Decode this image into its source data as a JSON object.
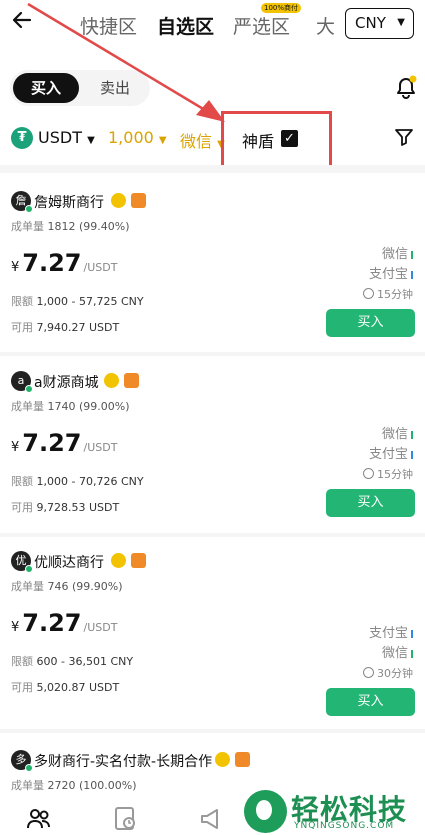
{
  "nav": {
    "back_icon": "back-arrow-icon",
    "tabs": [
      {
        "label": "快捷区",
        "active": false
      },
      {
        "label": "自选区",
        "active": true
      },
      {
        "label": "严选区",
        "active": false,
        "badge": "100%商付"
      },
      {
        "label": "大",
        "active": false
      }
    ],
    "currency": "CNY"
  },
  "trade": {
    "buy_label": "买入",
    "sell_label": "卖出"
  },
  "filters": {
    "coin": "USDT",
    "amount": "1,000",
    "payment": "微信",
    "shield_label": "神盾",
    "shield_checked": true
  },
  "merchants": [
    {
      "avatar": "詹",
      "name": "詹姆斯商行",
      "stats_label": "成单量",
      "stats": "1812 (99.40%)",
      "currency_symbol": "¥",
      "price": "7.27",
      "unit": "/USDT",
      "limit_label": "限额",
      "limit": "1,000 - 57,725 CNY",
      "avail_label": "可用",
      "available": "7,940.27 USDT",
      "payments": [
        "微信",
        "支付宝"
      ],
      "time": "15分钟",
      "buy_label": "买入"
    },
    {
      "avatar": "a",
      "name": "a财源商城",
      "stats_label": "成单量",
      "stats": "1740 (99.00%)",
      "currency_symbol": "¥",
      "price": "7.27",
      "unit": "/USDT",
      "limit_label": "限额",
      "limit": "1,000 - 70,726 CNY",
      "avail_label": "可用",
      "available": "9,728.53 USDT",
      "payments": [
        "微信",
        "支付宝"
      ],
      "time": "15分钟",
      "buy_label": "买入"
    },
    {
      "avatar": "优",
      "name": "优顺达商行",
      "stats_label": "成单量",
      "stats": "746 (99.90%)",
      "currency_symbol": "¥",
      "price": "7.27",
      "unit": "/USDT",
      "limit_label": "限额",
      "limit": "600 - 36,501 CNY",
      "avail_label": "可用",
      "available": "5,020.87 USDT",
      "payments": [
        "支付宝",
        "微信"
      ],
      "time": "30分钟",
      "buy_label": "买入"
    },
    {
      "avatar": "多",
      "name": "多财商行-实名付款-长期合作",
      "stats_label": "成单量",
      "stats": "2720 (100.00%)"
    }
  ],
  "watermark": {
    "title": "轻松科技",
    "subtitle": "YNQINGSONG.COM"
  },
  "colors": {
    "accent_gold": "#d9a400",
    "buy_green": "#22b574",
    "annotation_red": "#e24a4a"
  }
}
